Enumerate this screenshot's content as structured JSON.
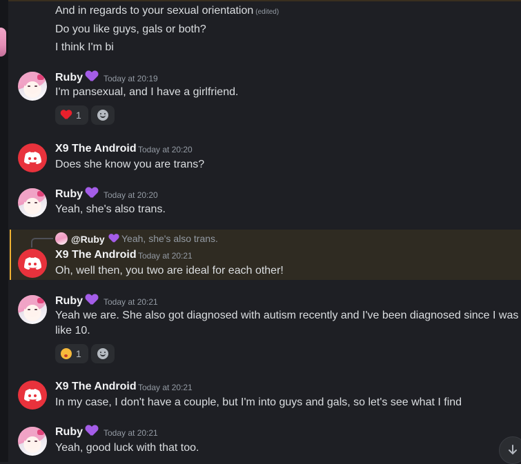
{
  "earlier": {
    "lines": [
      "And in regards to your sexual orientation",
      "Do you like guys, gals or both?",
      "I think I'm bi"
    ],
    "edited_label": "(edited)"
  },
  "messages": [
    {
      "author": "Ruby",
      "timestamp": "Today at 20:19",
      "text": "I'm pansexual, and I have a girlfriend.",
      "reaction": {
        "emoji": "red-heart",
        "count": "1"
      }
    },
    {
      "author": "X9 The Android",
      "timestamp": "Today at 20:20",
      "text": "Does she know you are trans?"
    },
    {
      "author": "Ruby",
      "timestamp": "Today at 20:20",
      "text": "Yeah, she's also trans."
    },
    {
      "author": "X9 The Android",
      "timestamp": "Today at 20:21",
      "text": "Oh, well then, you two are ideal for each other!",
      "reply": {
        "mention": "@Ruby",
        "text": "Yeah, she's also trans."
      }
    },
    {
      "author": "Ruby",
      "timestamp": "Today at 20:21",
      "text": "Yeah we are. She also got diagnosed with autism recently and I've been diagnosed since I was like 10.",
      "reaction": {
        "emoji": "kissing-face",
        "count": "1"
      }
    },
    {
      "author": "X9 The Android",
      "timestamp": "Today at 20:21",
      "text": "In my case, I don't have a couple, but I'm into guys and gals, so let's see what I find"
    },
    {
      "author": "Ruby",
      "timestamp": "Today at 20:21",
      "text": "Yeah, good luck with that too."
    }
  ],
  "colors": {
    "background": "#1e1f24",
    "highlight": "#2f2b22",
    "mention_bar": "#f0b232",
    "bot_avatar": "#e8323c",
    "heart": "#a45de8"
  }
}
